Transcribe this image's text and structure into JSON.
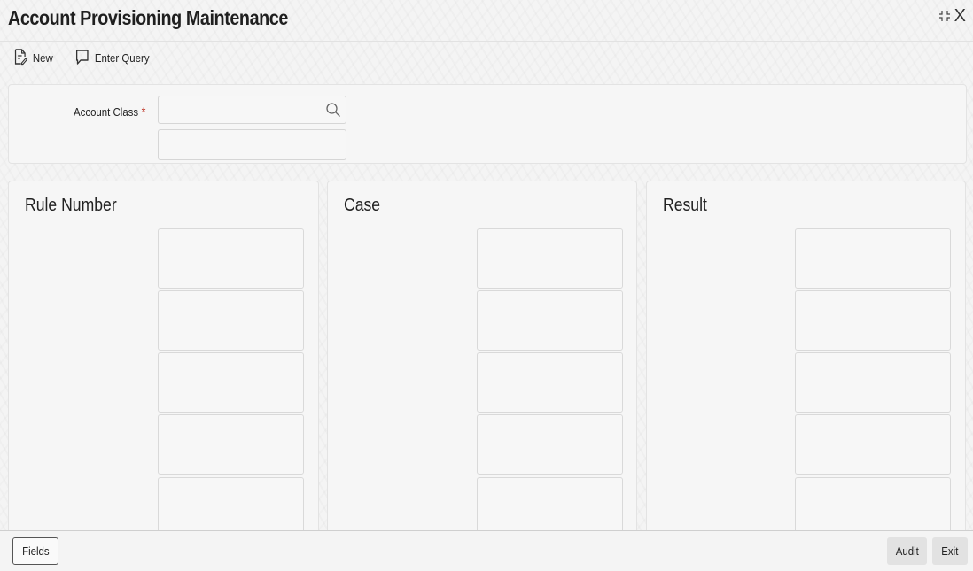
{
  "window": {
    "title": "Account Provisioning Maintenance",
    "close_label": "X"
  },
  "toolbar": {
    "new_label": "New",
    "enter_query_label": "Enter Query"
  },
  "header": {
    "account_class_label": "Account Class",
    "required_marker": "*"
  },
  "columns": {
    "rule_number": {
      "title": "Rule Number"
    },
    "case": {
      "title": "Case"
    },
    "result": {
      "title": "Result"
    }
  },
  "footer": {
    "fields_label": "Fields",
    "audit_label": "Audit",
    "exit_label": "Exit"
  }
}
